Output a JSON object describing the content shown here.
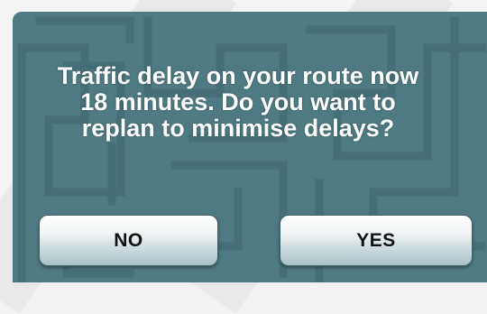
{
  "dialog": {
    "message_lines": [
      "Traffic delay on your route now",
      "18 minutes. Do you want to",
      "replan to minimise delays?"
    ],
    "background_color": "#4e7a82",
    "pattern_color": "#45707a"
  },
  "buttons": {
    "no_label": "NO",
    "yes_label": "YES"
  }
}
